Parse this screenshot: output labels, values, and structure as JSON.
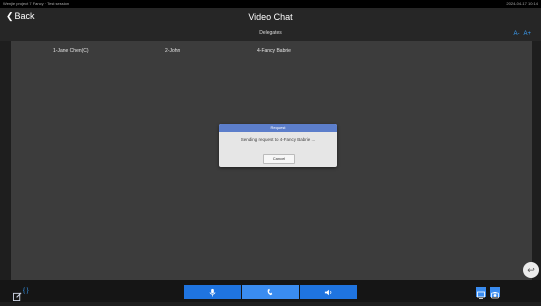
{
  "status": {
    "left": "Wenjie project 7 Fancy · Test session",
    "right": "2024-04-17 10:14"
  },
  "header": {
    "back_label": "Back",
    "title": "Video Chat"
  },
  "subheader": {
    "title": "Delegates",
    "font_decrease": "A-",
    "font_increase": "A+"
  },
  "participants": [
    "1-Jane Chen(C)",
    "2-John",
    "4-Fancy Babrie"
  ],
  "dialog": {
    "title": "Request",
    "message": "Sending request to 4-Fancy Babrie ...",
    "cancel_label": "Cancel"
  },
  "toolbar": {
    "expand_label": "{ }"
  },
  "colors": {
    "accent": "#1f74e0",
    "dialog_header": "#5c7ecb",
    "content_bg": "#3c3c3c"
  }
}
